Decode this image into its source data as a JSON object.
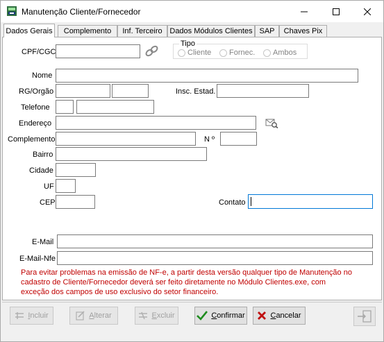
{
  "window": {
    "title": "Manutenção Cliente/Fornecedor",
    "minimize_glyph": "—",
    "maximize_glyph": "☐",
    "close_glyph": "✕"
  },
  "tabs": [
    {
      "label": "Dados Gerais",
      "active": true
    },
    {
      "label": "Complemento",
      "active": false
    },
    {
      "label": "Inf. Terceiro",
      "active": false
    },
    {
      "label": "Dados Módulos Clientes",
      "active": false
    },
    {
      "label": "SAP",
      "active": false
    },
    {
      "label": "Chaves Pix",
      "active": false
    }
  ],
  "form": {
    "cpf_label": "CPF/CGC",
    "cpf_value": "",
    "tipo_title": "Tipo",
    "tipo_options": [
      "Cliente",
      "Fornec.",
      "Ambos"
    ],
    "nome_label": "Nome",
    "rg_label": "RG/Orgão",
    "inscricao_label": "Insc. Estad.",
    "telefone_label": "Telefone",
    "endereco_label": "Endereço",
    "complemento_label": "Complemento",
    "numero_label": "N º",
    "bairro_label": "Bairro",
    "cidade_label": "Cidade",
    "uf_label": "UF",
    "cep_label": "CEP",
    "contato_label": "Contato",
    "email_label": "E-Mail",
    "email_nfe_label": "E-Mail-Nfe"
  },
  "note": "Para evitar problemas na emissão de NF-e, a partir desta versão qualquer tipo de Manutenção no cadastro de Cliente/Fornecedor deverá ser feito diretamente no Módulo Clientes.exe, com exceção dos campos de uso exclusivo do setor financeiro.",
  "buttons": {
    "incluir": {
      "first": "I",
      "rest": "ncluir"
    },
    "alterar": {
      "first": "A",
      "rest": "lterar"
    },
    "excluir": {
      "first": "E",
      "rest": "xcluir"
    },
    "confirmar": {
      "first": "C",
      "rest": "onfirmar"
    },
    "cancelar": {
      "first": "C",
      "rest": "ancelar"
    }
  },
  "colors": {
    "note": "#c00000",
    "confirm": "#1e8c1e",
    "cancel": "#c01010",
    "focus": "#0078d7"
  }
}
